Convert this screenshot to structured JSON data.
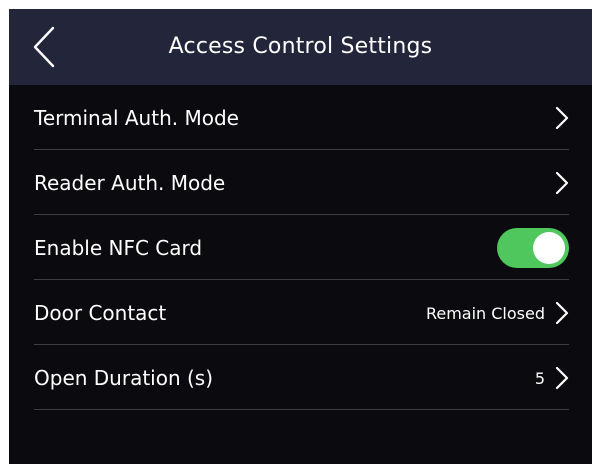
{
  "header": {
    "title": "Access Control Settings",
    "back_icon": "chevron-left-icon"
  },
  "settings": [
    {
      "label": "Terminal Auth. Mode",
      "value": "",
      "control": "chevron"
    },
    {
      "label": "Reader Auth. Mode",
      "value": "",
      "control": "chevron"
    },
    {
      "label": "Enable NFC Card",
      "value": "",
      "control": "toggle",
      "toggle_on": true
    },
    {
      "label": "Door Contact",
      "value": "Remain Closed",
      "control": "chevron"
    },
    {
      "label": "Open Duration (s)",
      "value": "5",
      "control": "chevron"
    }
  ],
  "colors": {
    "header_bg": "#23263a",
    "screen_bg": "#0b0b0f",
    "toggle_on": "#4fc75c",
    "divider": "#3e3e44",
    "text": "#ffffff"
  }
}
